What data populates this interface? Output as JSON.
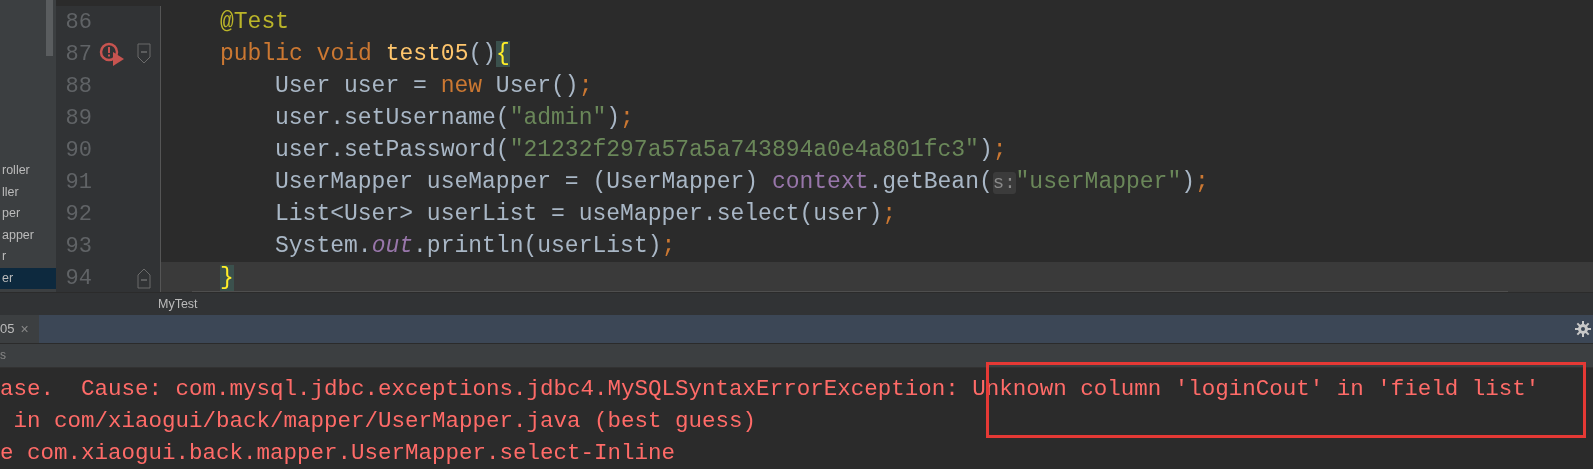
{
  "project_tree": {
    "items": [
      {
        "label": "roller",
        "selected": false
      },
      {
        "label": "ller",
        "selected": false
      },
      {
        "label": "per",
        "selected": false
      },
      {
        "label": "apper",
        "selected": false
      },
      {
        "label": "r",
        "selected": false
      },
      {
        "label": "er",
        "selected": true
      }
    ]
  },
  "editor": {
    "lines": [
      {
        "number": "86",
        "current": false,
        "tokens": [
          {
            "kind": "annotation",
            "text": "@Test"
          }
        ]
      },
      {
        "number": "87",
        "current": false,
        "error_marker": true,
        "fold_start": true,
        "tokens": [
          {
            "kind": "keyword",
            "text": "public void "
          },
          {
            "kind": "method",
            "text": "test05"
          },
          {
            "kind": "plain",
            "text": "()"
          },
          {
            "kind": "brace",
            "text": "{"
          }
        ],
        "children": [
          {
            "number": "88",
            "current": false,
            "tokens": [
              {
                "kind": "plain",
                "text": "User user = "
              },
              {
                "kind": "keyword",
                "text": "new "
              },
              {
                "kind": "plain",
                "text": "User()"
              },
              {
                "kind": "keyword",
                "text": ";"
              }
            ]
          },
          {
            "number": "89",
            "current": false,
            "tokens": [
              {
                "kind": "plain",
                "text": "user.setUsername("
              },
              {
                "kind": "string",
                "text": "\"admin\""
              },
              {
                "kind": "plain",
                "text": ")"
              },
              {
                "kind": "keyword",
                "text": ";"
              }
            ]
          },
          {
            "number": "90",
            "current": false,
            "tokens": [
              {
                "kind": "plain",
                "text": "user.setPassword("
              },
              {
                "kind": "string",
                "text": "\"21232f297a57a5a743894a0e4a801fc3\""
              },
              {
                "kind": "plain",
                "text": ")"
              },
              {
                "kind": "keyword",
                "text": ";"
              }
            ]
          },
          {
            "number": "91",
            "current": false,
            "tokens": [
              {
                "kind": "plain",
                "text": "UserMapper useMapper = (UserMapper) "
              },
              {
                "kind": "field",
                "text": "context"
              },
              {
                "kind": "plain",
                "text": ".getBean("
              },
              {
                "kind": "hint",
                "text": "s:"
              },
              {
                "kind": "string",
                "text": "\"userMapper\""
              },
              {
                "kind": "plain",
                "text": ")"
              },
              {
                "kind": "keyword",
                "text": ";"
              }
            ]
          },
          {
            "number": "92",
            "current": false,
            "tokens": [
              {
                "kind": "plain",
                "text": "List<User> userList = useMapper.select(user)"
              },
              {
                "kind": "keyword",
                "text": ";"
              }
            ]
          },
          {
            "number": "93",
            "current": false,
            "tokens": [
              {
                "kind": "plain",
                "text": "System."
              },
              {
                "kind": "static",
                "text": "out"
              },
              {
                "kind": "plain",
                "text": ".println(userList)"
              },
              {
                "kind": "keyword",
                "text": ";"
              }
            ]
          }
        ]
      },
      {
        "number": "94",
        "current": true,
        "fold_end": true,
        "tokens": [
          {
            "kind": "brace",
            "text": "}"
          }
        ]
      }
    ]
  },
  "breadcrumb": "MyTest",
  "run_panel": {
    "tab": {
      "label": "05",
      "close": "×"
    },
    "toolbar_label": "s",
    "console_lines": [
      "ase.  Cause: com.mysql.jdbc.exceptions.jdbc4.MySQLSyntaxErrorException: Unknown column 'loginCout' in 'field list'",
      " in com/xiaogui/back/mapper/UserMapper.java (best guess)",
      "e com.xiaogui.back.mapper.UserMapper.select-Inline"
    ]
  }
}
